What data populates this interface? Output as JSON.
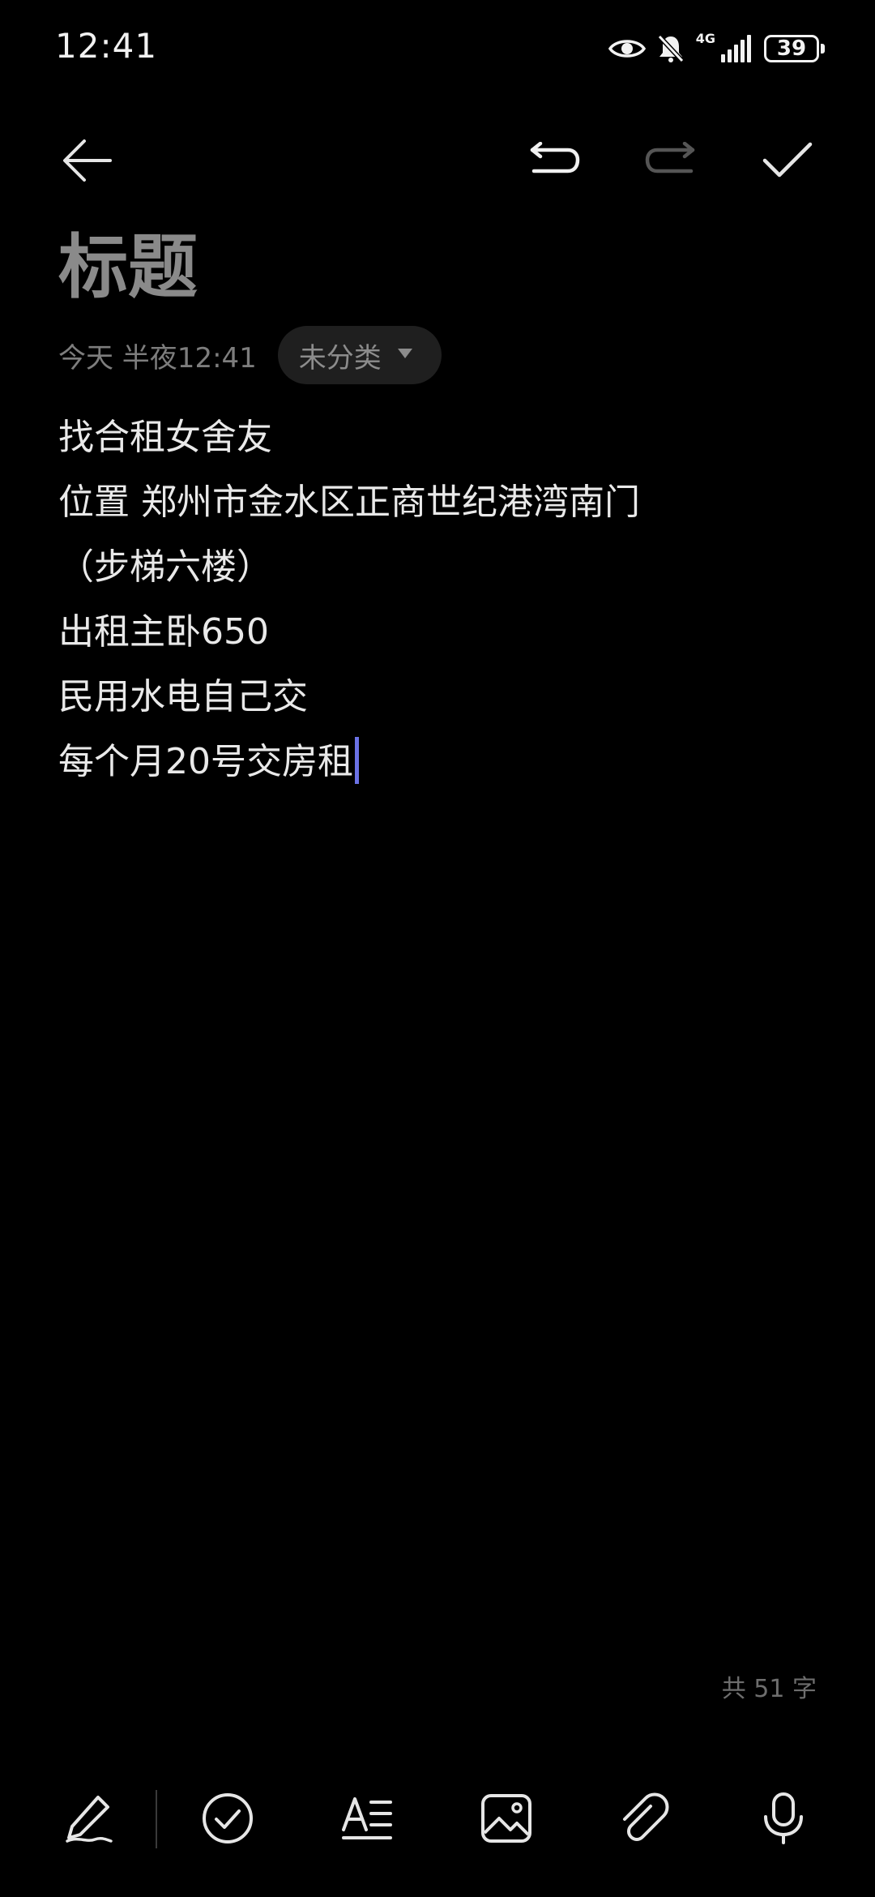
{
  "status_bar": {
    "time": "12:41",
    "network": "4G",
    "battery": "39",
    "icons": [
      "eye-icon",
      "bell-off-icon",
      "signal-icon",
      "battery-icon"
    ]
  },
  "toolbar": {
    "icons": [
      "back-arrow-icon",
      "undo-icon",
      "redo-icon",
      "check-icon"
    ]
  },
  "note": {
    "title": "标题",
    "date": "今天 半夜12:41",
    "category": "未分类",
    "lines": [
      "找合租女舍友",
      "位置 郑州市金水区正商世纪港湾南门",
      "（步梯六楼）",
      "出租主卧650",
      "民用水电自己交",
      "每个月20号交房租"
    ],
    "word_count": "共 51 字"
  },
  "bottom_toolbar": {
    "icons": [
      "handwriting-pen-icon",
      "checklist-icon",
      "text-format-icon",
      "image-icon",
      "attachment-icon",
      "microphone-icon"
    ]
  },
  "colors": {
    "background": "#000000",
    "text": "#e9e9e9",
    "title": "#8a8a8a",
    "muted": "#7d7d7d",
    "chip_background": "#1f1f1f",
    "caret": "#6b72e6",
    "redo_disabled": "#555555"
  }
}
